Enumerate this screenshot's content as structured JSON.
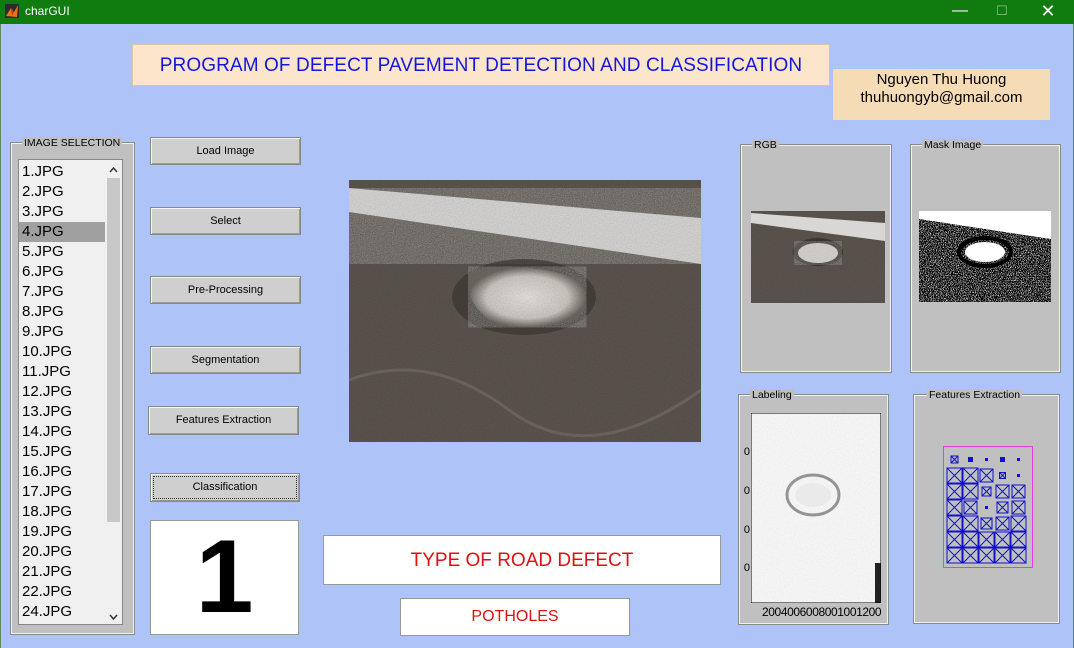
{
  "window": {
    "title": "charGUI",
    "minimize": "—",
    "maximize": "☐",
    "close": "✕"
  },
  "header": {
    "title": "PROGRAM OF DEFECT PAVEMENT DETECTION AND CLASSIFICATION",
    "author_name": "Nguyen Thu Huong",
    "author_email": "thuhuongyb@gmail.com"
  },
  "image_selection": {
    "label": "IMAGE SELECTION",
    "items": [
      "1.JPG",
      "2.JPG",
      "3.JPG",
      "4.JPG",
      "5.JPG",
      "6.JPG",
      "7.JPG",
      "8.JPG",
      "9.JPG",
      "10.JPG",
      "11.JPG",
      "12.JPG",
      "13.JPG",
      "14.JPG",
      "15.JPG",
      "16.JPG",
      "17.JPG",
      "18.JPG",
      "19.JPG",
      "20.JPG",
      "21.JPG",
      "22.JPG",
      "24.JPG"
    ],
    "selected": "4.JPG"
  },
  "buttons": {
    "load": "Load Image",
    "select": "Select",
    "preprocessing": "Pre-Processing",
    "segmentation": "Segmentation",
    "features": "Features Extraction",
    "classification": "Classification"
  },
  "result": {
    "class_number": "1",
    "type_heading": "TYPE OF ROAD DEFECT",
    "defect_name": "POTHOLES"
  },
  "panels": {
    "rgb": "RGB",
    "mask": "Mask Image",
    "labeling": "Labeling",
    "features": "Features Extraction"
  },
  "labeling_axes": {
    "yticks": [
      "0",
      "0",
      "0",
      "0"
    ],
    "xticks": "2004006008001001200"
  },
  "colors": {
    "title_blue": "#1515e0",
    "result_red": "#e01010",
    "background": "#aec3f8",
    "titlebar": "#107c10"
  }
}
